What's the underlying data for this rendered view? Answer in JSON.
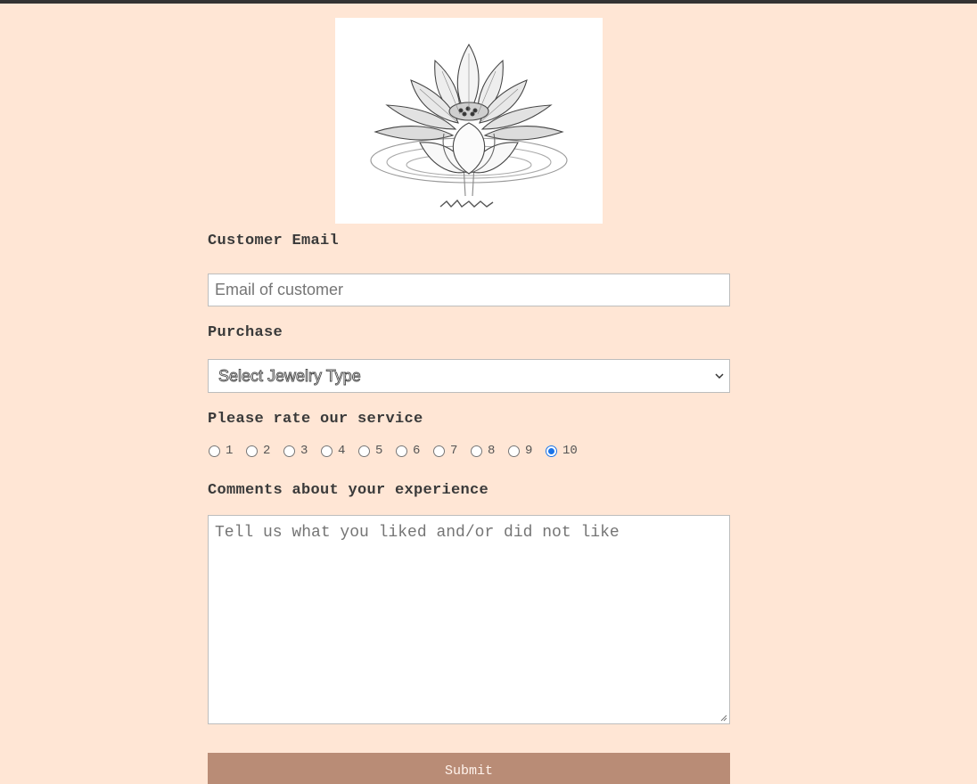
{
  "form": {
    "email_label": "Customer Email",
    "email_placeholder": "Email of customer",
    "purchase_label": "Purchase",
    "purchase_selected": "Select Jewelry Type",
    "rating_label": "Please rate our service",
    "rating_options": [
      "1",
      "2",
      "3",
      "4",
      "5",
      "6",
      "7",
      "8",
      "9",
      "10"
    ],
    "rating_selected": "10",
    "comments_label": "Comments about your experience",
    "comments_placeholder": "Tell us what you liked and/or did not like",
    "submit_label": "Submit"
  },
  "colors": {
    "background": "#ffe6d5",
    "submit_button": "#b98c76",
    "radio_selected": "#1a73e8"
  },
  "icons": {
    "logo": "lotus-flower-logo",
    "select_arrow": "chevron-down-icon",
    "textarea_resize": "resize-handle-icon"
  }
}
